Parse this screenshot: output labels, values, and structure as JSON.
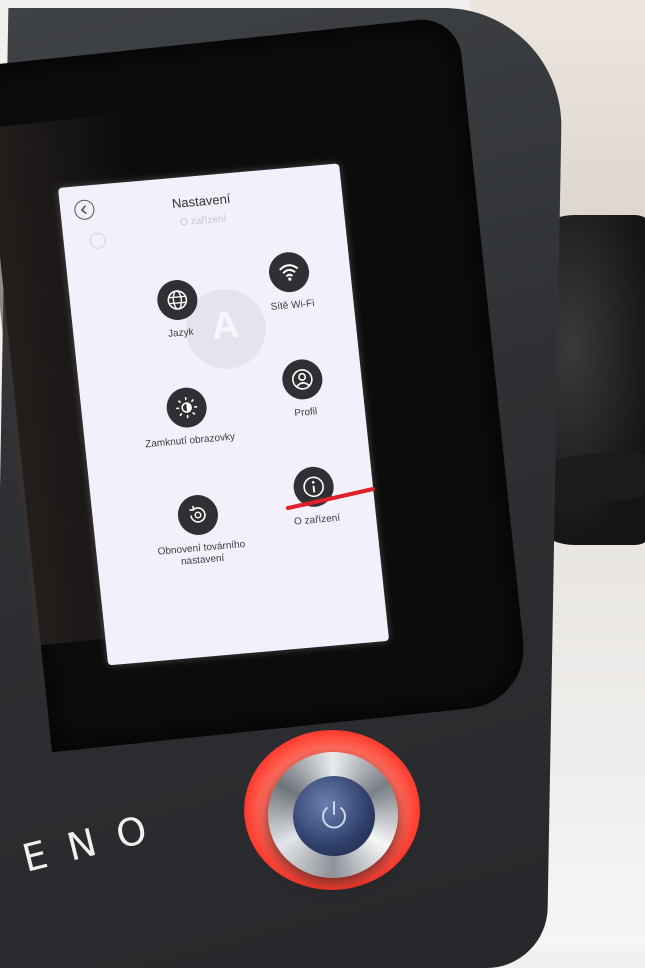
{
  "screen": {
    "title": "Nastavení",
    "subtitle": "O zařízení",
    "menu": [
      {
        "label": "Jazyk",
        "icon": "globe-icon"
      },
      {
        "label": "Sítě Wi-Fi",
        "icon": "wifi-icon"
      },
      {
        "label": "Zamknutí obrazovky",
        "icon": "brightness-icon"
      },
      {
        "label": "Profil",
        "icon": "profile-icon"
      },
      {
        "label": "Obnovení továrního nastavení",
        "icon": "factory-reset-icon"
      },
      {
        "label": "O zařízení",
        "icon": "info-icon"
      }
    ]
  },
  "device": {
    "brand": "ENO",
    "power_ring_color": "#ff4b3c"
  },
  "annotation": {
    "color": "#e0202a",
    "target": "O zařízení"
  }
}
